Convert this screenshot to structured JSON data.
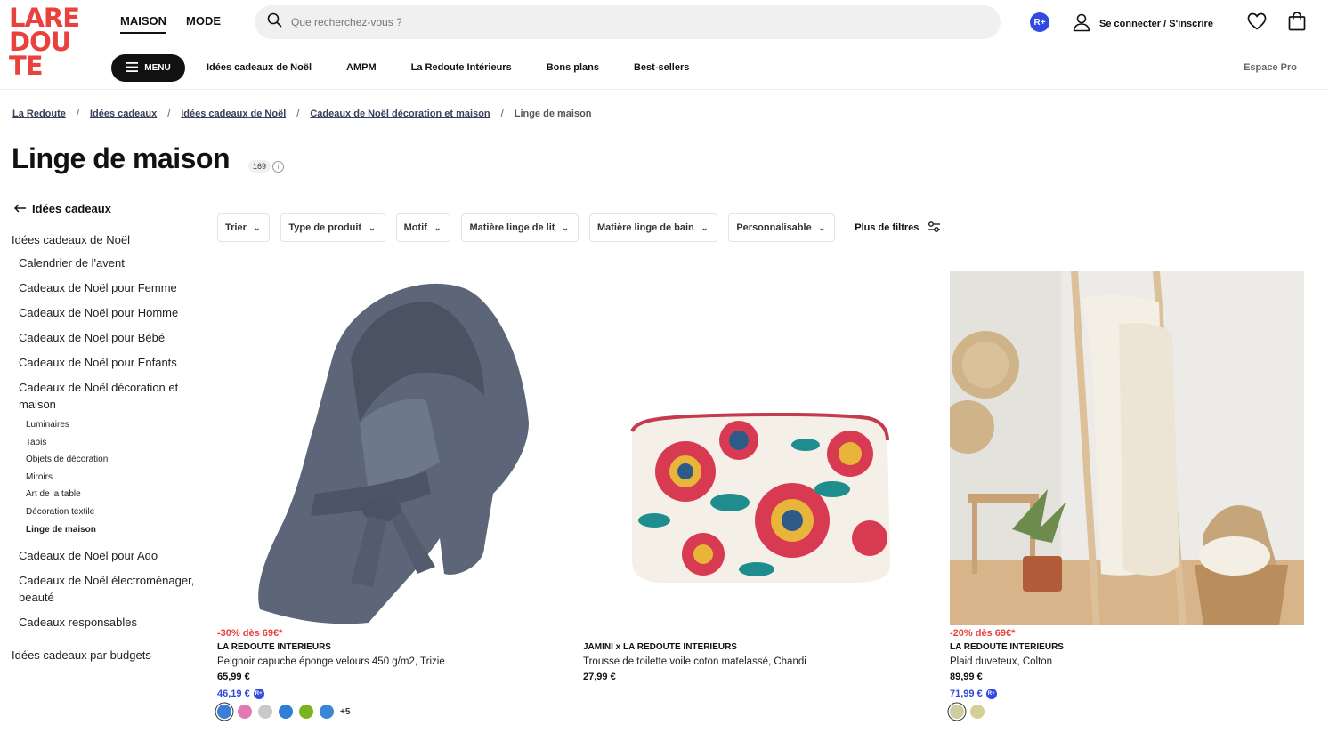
{
  "header": {
    "logo_lines": [
      "LARE",
      "DOU",
      "TE"
    ],
    "top_nav": [
      {
        "label": "MAISON",
        "active": true
      },
      {
        "label": "MODE",
        "active": false
      }
    ],
    "search_placeholder": "Que recherchez-vous ?",
    "rplus_badge": "R+",
    "account_label": "Se connecter / S'inscrire",
    "icons": [
      "search-icon",
      "user-icon",
      "heart-icon",
      "bag-icon"
    ]
  },
  "subnav": {
    "menu_label": "MENU",
    "items": [
      "Idées cadeaux de Noël",
      "AMPM",
      "La Redoute Intérieurs",
      "Bons plans",
      "Best-sellers"
    ],
    "pro_label": "Espace Pro"
  },
  "breadcrumb": [
    "La Redoute",
    "Idées cadeaux",
    "Idées cadeaux de Noël",
    "Cadeaux de Noël décoration et maison",
    "Linge de maison"
  ],
  "page": {
    "title": "Linge de maison",
    "count": "169",
    "info_glyph": "i"
  },
  "sidebar": {
    "back_label": "Idées cadeaux",
    "parent": "Idées cadeaux de Noël",
    "children": [
      "Calendrier de l'avent",
      "Cadeaux de Noël pour Femme",
      "Cadeaux de Noël pour Homme",
      "Cadeaux de Noël pour Bébé",
      "Cadeaux de Noël pour Enfants",
      "Cadeaux de Noël décoration et maison"
    ],
    "subchildren": [
      "Luminaires",
      "Tapis",
      "Objets de décoration",
      "Miroirs",
      "Art de la table",
      "Décoration textile",
      "Linge de maison"
    ],
    "active_subchild": "Linge de maison",
    "after_children": [
      "Cadeaux de Noël pour Ado",
      "Cadeaux de Noël électroménager, beauté",
      "Cadeaux responsables"
    ],
    "budgets": "Idées cadeaux par budgets"
  },
  "filters": {
    "items": [
      "Trier",
      "Type de produit",
      "Motif",
      "Matière linge de lit",
      "Matière linge de bain",
      "Personnalisable"
    ],
    "more_label": "Plus de filtres"
  },
  "products": [
    {
      "promo": "-30% dès 69€*",
      "brand": "LA REDOUTE INTERIEURS",
      "name": "Peignoir capuche éponge velours 450 g/m2, Trizie",
      "price": "65,99 €",
      "member_price": "46,19 €",
      "member_badge": "R+",
      "swatches": [
        "#3a7fd5",
        "#e27ab0",
        "#c9c9c9",
        "#2f7fd6",
        "#7ab51d",
        "#3a86d6"
      ],
      "selected_swatch": 0,
      "more_colors": "+5"
    },
    {
      "promo": "",
      "brand": "JAMINI x LA REDOUTE INTERIEURS",
      "name": "Trousse de toilette voile coton matelassé, Chandi",
      "price": "27,99 €",
      "member_price": "",
      "member_badge": "",
      "swatches": [],
      "selected_swatch": -1,
      "more_colors": ""
    },
    {
      "promo": "-20% dès 69€*",
      "brand": "LA REDOUTE INTERIEURS",
      "name": "Plaid duveteux, Colton",
      "price": "89,99 €",
      "member_price": "71,99 €",
      "member_badge": "R+",
      "swatches": [
        "#cfcca0",
        "#d4cf95"
      ],
      "selected_swatch": 0,
      "more_colors": ""
    }
  ],
  "colors": {
    "brand_red": "#e8413e",
    "member_blue": "#3049d9",
    "promo_red": "#e8413e"
  }
}
